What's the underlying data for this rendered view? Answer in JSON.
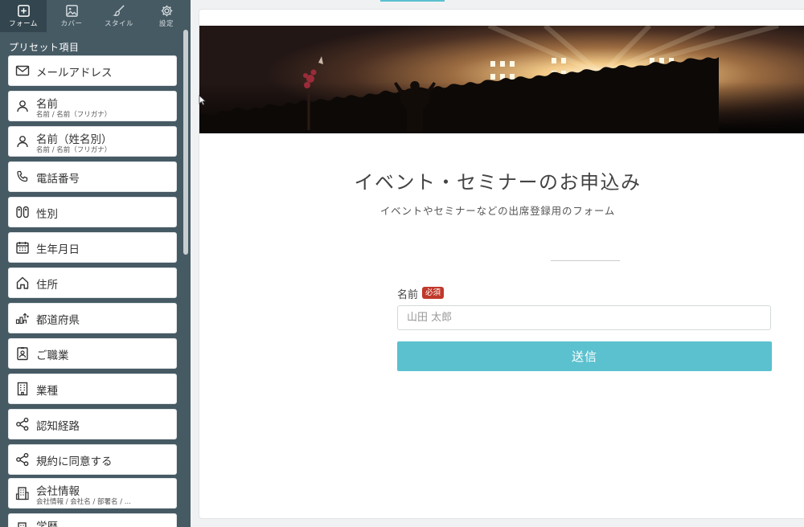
{
  "tabs": [
    {
      "label": "フォーム",
      "icon": "plus-square-icon",
      "active": true
    },
    {
      "label": "カバー",
      "icon": "image-icon",
      "active": false
    },
    {
      "label": "スタイル",
      "icon": "brush-icon",
      "active": false
    },
    {
      "label": "設定",
      "icon": "gear-icon",
      "active": false
    }
  ],
  "sidebar": {
    "heading": "プリセット項目",
    "items": [
      {
        "label": "メールアドレス",
        "icon": "mail-icon"
      },
      {
        "label": "名前",
        "sub": "名前 / 名前（フリガナ）",
        "icon": "person-icon"
      },
      {
        "label": "名前（姓名別）",
        "sub": "名前 / 名前（フリガナ）",
        "icon": "person-icon"
      },
      {
        "label": "電話番号",
        "icon": "phone-icon"
      },
      {
        "label": "性別",
        "icon": "gender-icon"
      },
      {
        "label": "生年月日",
        "icon": "calendar-icon"
      },
      {
        "label": "住所",
        "icon": "home-icon"
      },
      {
        "label": "都道府県",
        "icon": "map-icon"
      },
      {
        "label": "ご職業",
        "icon": "id-badge-icon"
      },
      {
        "label": "業種",
        "icon": "building-icon"
      },
      {
        "label": "認知経路",
        "icon": "share-icon"
      },
      {
        "label": "規約に同意する",
        "icon": "share-icon"
      },
      {
        "label": "会社情報",
        "sub": "会社情報 / 会社名 / 部署名 / ...",
        "icon": "company-icon"
      },
      {
        "label": "学歴",
        "icon": "education-icon"
      }
    ]
  },
  "form": {
    "title": "イベント・セミナーのお申込み",
    "description": "イベントやセミナーなどの出席登録用のフォーム",
    "name_label": "名前",
    "required_badge": "必須",
    "name_placeholder": "山田 太郎",
    "submit_label": "送信"
  },
  "colors": {
    "sidebar_bg": "#465a64",
    "accent": "#5bc1cf",
    "required": "#c0392b"
  }
}
